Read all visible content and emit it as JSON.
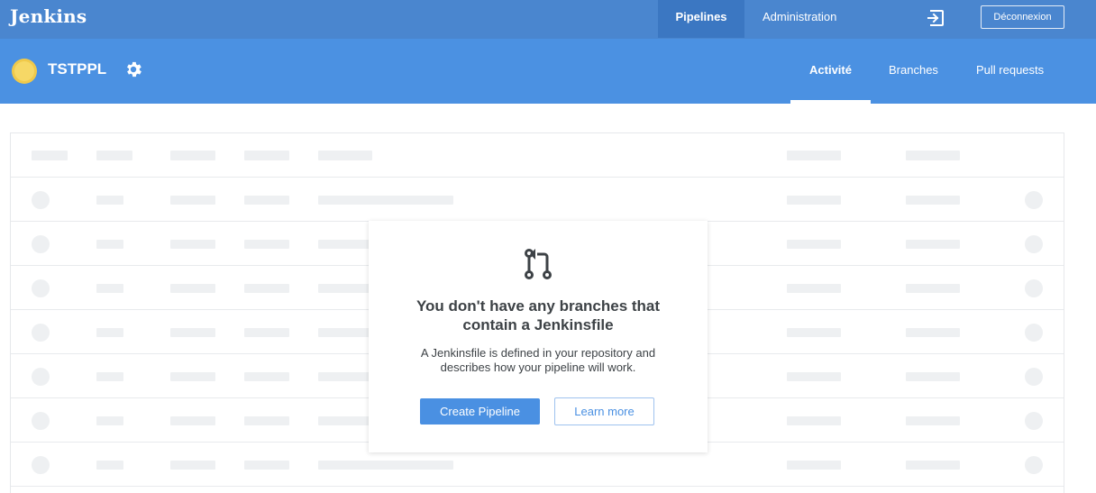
{
  "app": {
    "logo": "Jenkins"
  },
  "topnav": {
    "pipelines": "Pipelines",
    "administration": "Administration",
    "logout": "Déconnexion"
  },
  "pipeline": {
    "name": "TSTPPL",
    "weather_icon": "sunny-weather-icon",
    "settings_icon": "gear-icon"
  },
  "tabs": [
    {
      "label": "Activité",
      "active": true
    },
    {
      "label": "Branches",
      "active": false
    },
    {
      "label": "Pull requests",
      "active": false
    }
  ],
  "empty_state": {
    "icon": "pull-request-icon",
    "title": "You don't have any branches that contain a Jenkinsfile",
    "description": "A Jenkinsfile is defined in your repository and describes how your pipeline will work.",
    "primary_button": "Create Pipeline",
    "secondary_button": "Learn more"
  },
  "colors": {
    "topbar": "#4a86cf",
    "subheader": "#4b91e2",
    "accent": "#4a90e2",
    "weather_sun": "#f6d866",
    "skeleton": "#eef0f2"
  }
}
